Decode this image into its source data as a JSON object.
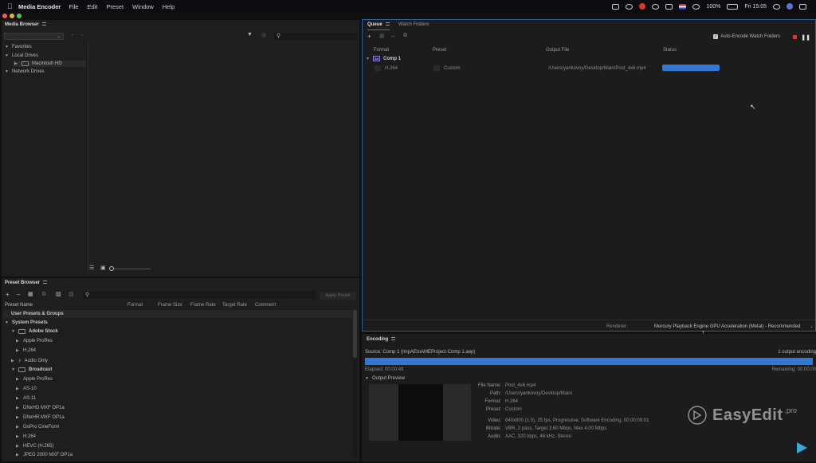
{
  "menubar": {
    "app_name": "Media Encoder",
    "items": [
      "File",
      "Edit",
      "Preset",
      "Window",
      "Help"
    ],
    "battery": "100%",
    "clock": "Fri 15:05"
  },
  "media_browser": {
    "title": "Media Browser",
    "favorites": "Favorites",
    "local_drives": "Local Drives",
    "macintosh_hd": "Macintosh HD",
    "network_drives": "Network Drives"
  },
  "preset_browser": {
    "title": "Preset Browser",
    "apply_preset": "Apply Preset",
    "columns": [
      "Preset Name",
      "Format",
      "Frame Size",
      "Frame Rate",
      "Target Rate",
      "Comment"
    ],
    "user_presets": "User Presets & Groups",
    "system_presets": "System Presets",
    "adobe_stock": "Adobe Stock",
    "stock_items": [
      "Apple ProRes",
      "H.264"
    ],
    "audio_only": "Audio Only",
    "broadcast": "Broadcast",
    "broadcast_items": [
      "Apple ProRes",
      "AS-10",
      "AS-11",
      "DNxHD MXF OP1a",
      "DNxHR MXF OP1a",
      "GoPro CineForm",
      "H.264",
      "HEVC (H.265)",
      "JPEG 2000 MXF OP1a"
    ]
  },
  "queue": {
    "tab_queue": "Queue",
    "tab_watch": "Watch Folders",
    "auto_encode": "Auto-Encode Watch Folders",
    "columns": [
      "Format",
      "Preset",
      "Output File",
      "Status"
    ],
    "group_name": "Comp 1",
    "item": {
      "format": "H.264",
      "preset": "Custom",
      "output": "/Users/yankovoy/Desktop/Main/Post_4x6.mp4",
      "progress": 1.0
    },
    "renderer_label": "Renderer:",
    "renderer_value": "Mercury Playback Engine GPU Acceleration (Metal) - Recommended"
  },
  "encoding": {
    "title": "Encoding",
    "source": "Source: Comp 1 (ImpAEtoAMEProject-Comp 1.aep)",
    "count": "1 output encoding",
    "elapsed": "Elapsed: 00:00:49",
    "remaining": "Remaining: 00:00:00",
    "progress": 1.0,
    "output_preview": "Output Preview",
    "details": [
      {
        "label": "File Name:",
        "value": "Post_4x6.mp4"
      },
      {
        "label": "Path:",
        "value": "/Users/yankovoy/Desktop/Main/"
      },
      {
        "label": "Format:",
        "value": "H.264"
      },
      {
        "label": "Preset:",
        "value": "Custom"
      },
      {
        "label": "Video:",
        "value": "640x800 (1,0), 25 fps, Progressive, Software Encoding, 00:00:09:01"
      },
      {
        "label": "Bitrate:",
        "value": "VBR, 2 pass, Target 3.60 Mbps, Max 4.00 Mbps"
      },
      {
        "label": "Audio:",
        "value": "AAC, 320 kbps, 48 kHz, Stereo"
      }
    ]
  },
  "watermark": {
    "brand": "EasyEdit",
    "suffix": ".pro"
  },
  "colors": {
    "accent_blue": "#2f78d6",
    "panel": "#1e1e1e",
    "background": "#101010"
  }
}
